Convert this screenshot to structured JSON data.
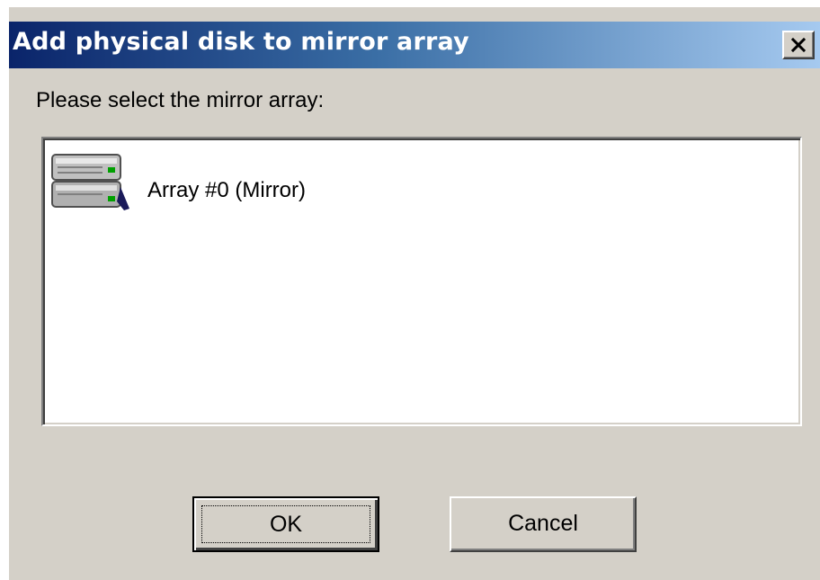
{
  "window": {
    "title": "Add physical disk to mirror array",
    "close_glyph": "×"
  },
  "prompt": "Please select the mirror array:",
  "arrays": [
    {
      "label": "Array #0 (Mirror)",
      "icon": "disk-array-icon"
    }
  ],
  "buttons": {
    "ok_label": "OK",
    "cancel_label": "Cancel"
  },
  "colors": {
    "title_gradient_start": "#0a246a",
    "title_gradient_end": "#a6caf0",
    "dialog_face": "#d4d0c8"
  }
}
